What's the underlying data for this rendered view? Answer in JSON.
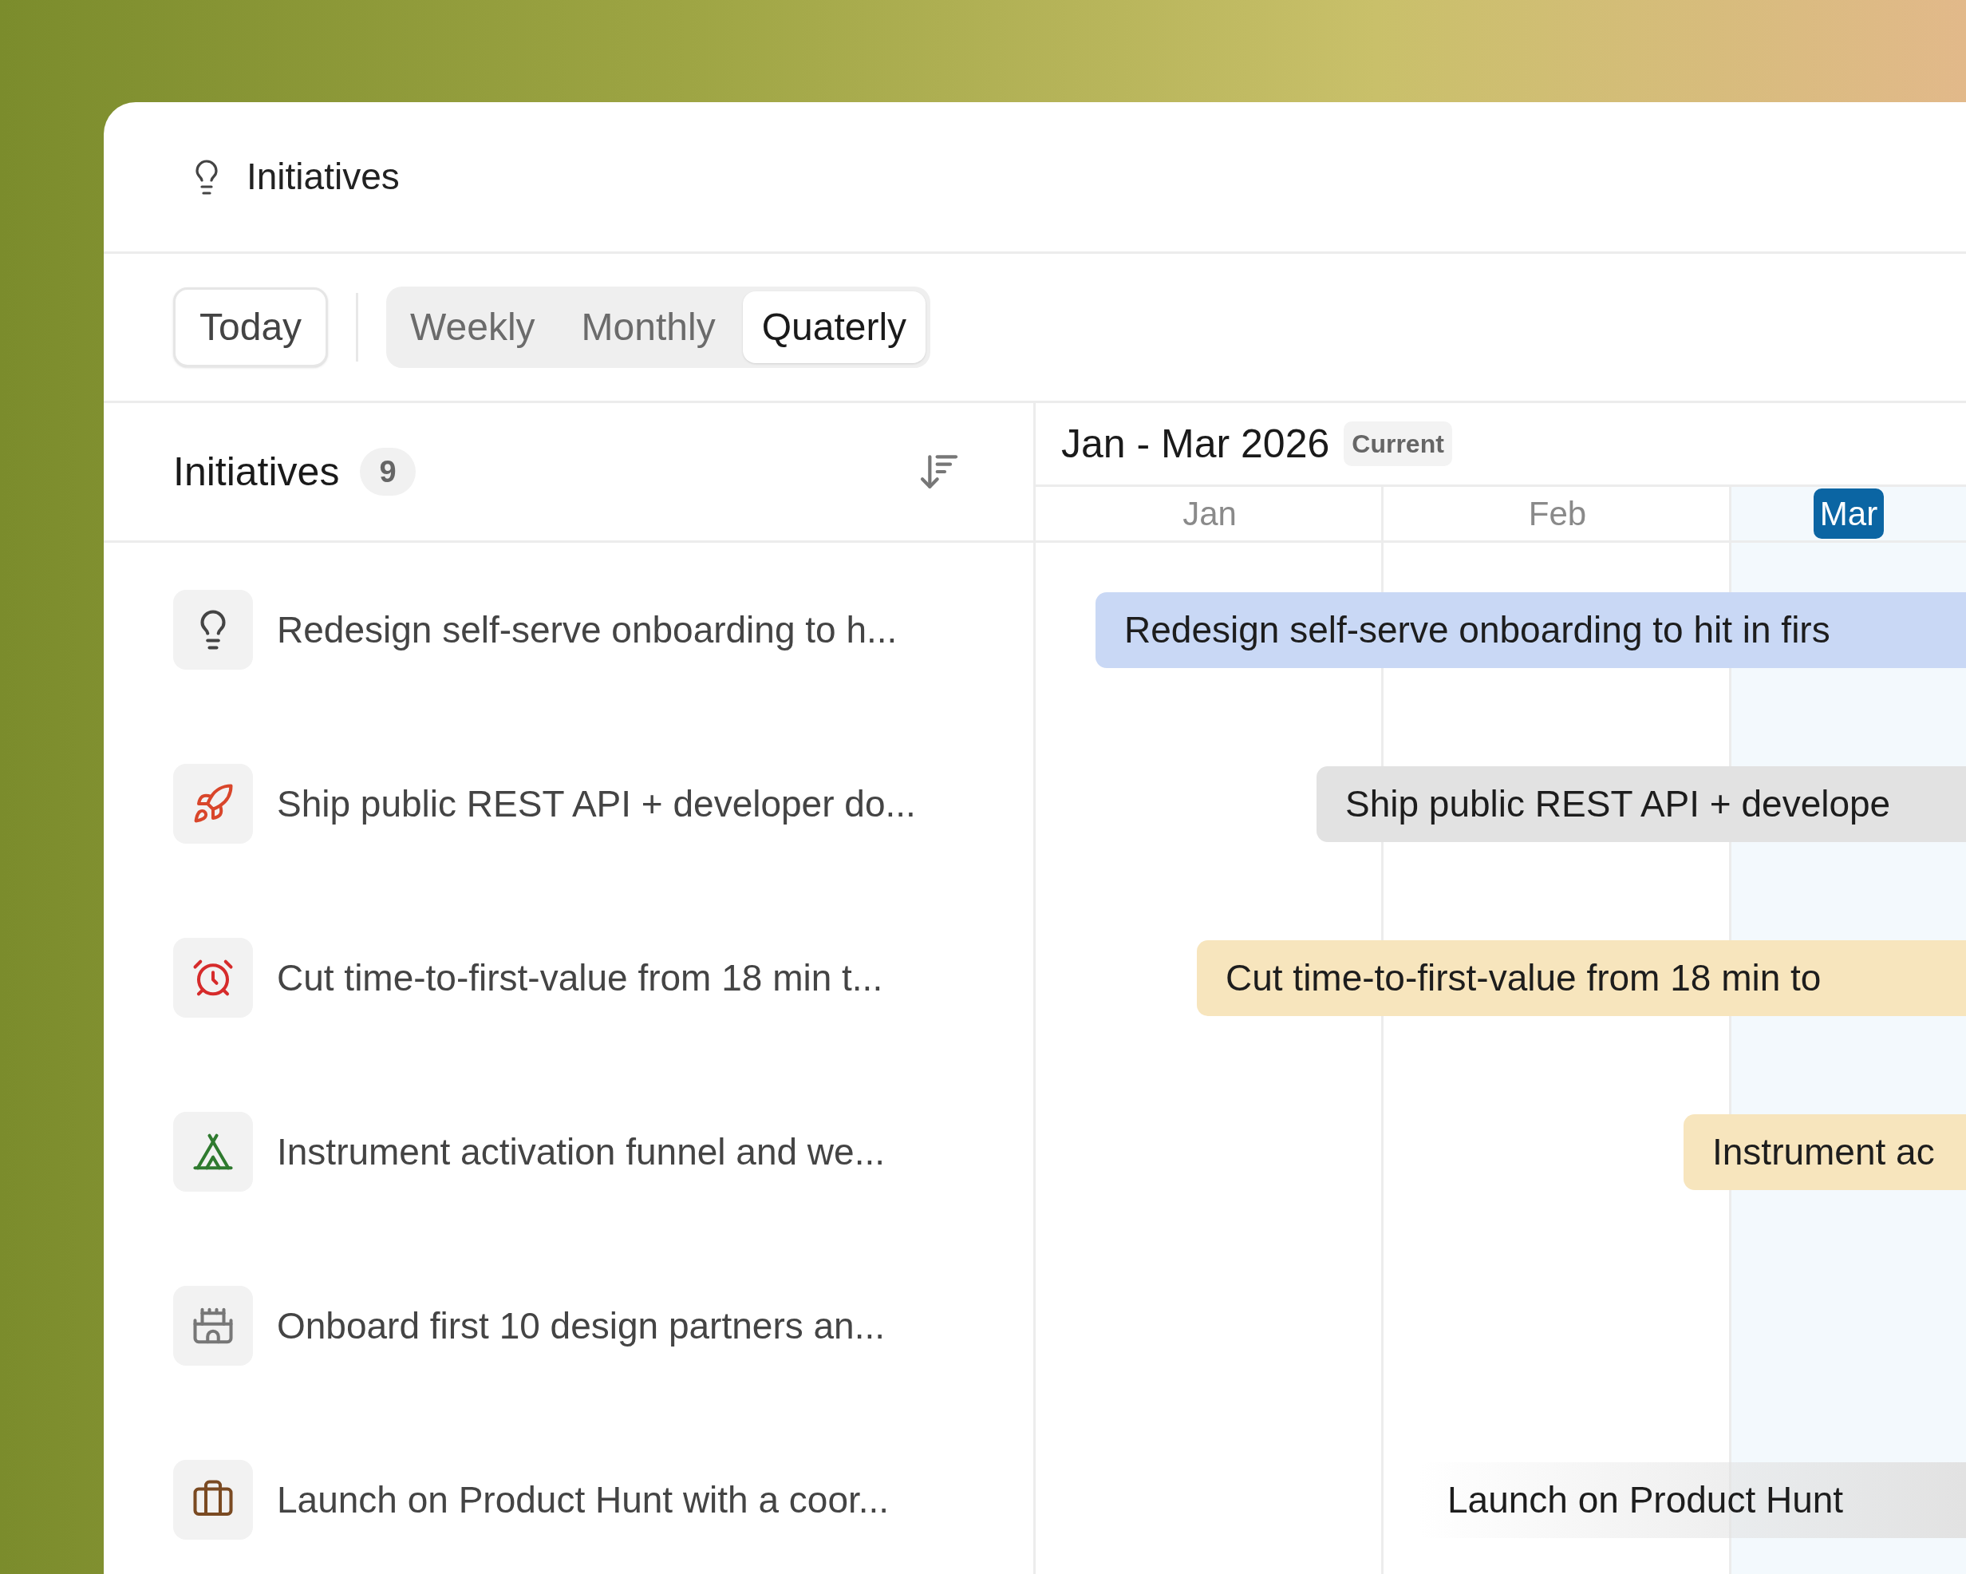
{
  "header": {
    "title": "Initiatives"
  },
  "toolbar": {
    "today": "Today",
    "tabs": [
      {
        "label": "Weekly",
        "selected": false
      },
      {
        "label": "Monthly",
        "selected": false
      },
      {
        "label": "Quaterly",
        "selected": true
      }
    ]
  },
  "list": {
    "title": "Initiatives",
    "count": "9"
  },
  "timeline": {
    "period": "Jan - Mar 2026",
    "badge": "Current",
    "months": [
      {
        "label": "Jan",
        "selected": false
      },
      {
        "label": "Feb",
        "selected": false
      },
      {
        "label": "Mar",
        "selected": true
      }
    ]
  },
  "rows": [
    {
      "title": "Redesign self-serve onboarding to h...",
      "bar": {
        "label": "Redesign self-serve onboarding to hit in firs",
        "color": "#c9d8f5",
        "faded": false
      }
    },
    {
      "title": "Ship public REST API + developer do...",
      "bar": {
        "label": "Ship public REST API + develope",
        "color": "#e2e2e2",
        "faded": false
      }
    },
    {
      "title": "Cut time-to-first-value from 18 min t...",
      "bar": {
        "label": "Cut time-to-first-value from 18 min to",
        "color": "#f7e5bd",
        "faded": false
      }
    },
    {
      "title": "Instrument activation funnel and we...",
      "bar": {
        "label": "Instrument ac",
        "color": "#f7e5bd",
        "faded": false
      }
    },
    {
      "title": "Onboard first 10 design partners an..."
    },
    {
      "title": "Launch on Product Hunt with a coor...",
      "bar": {
        "label": "Launch on Product Hunt",
        "color": "#e2e2e2",
        "faded": true
      }
    }
  ]
}
